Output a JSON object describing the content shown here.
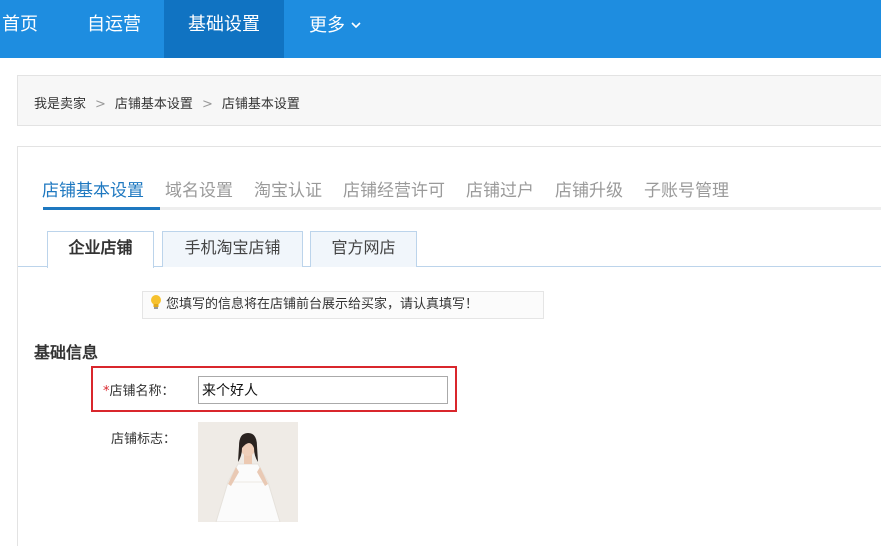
{
  "topnav": {
    "items": [
      {
        "label": "首页"
      },
      {
        "label": "自运营"
      },
      {
        "label": "基础设置"
      },
      {
        "label": "更多"
      }
    ],
    "more_chevron": "chevron-down-icon"
  },
  "breadcrumb": {
    "items": [
      "我是卖家",
      "店铺基本设置",
      "店铺基本设置"
    ],
    "separator": ">"
  },
  "primary_tabs": [
    "店铺基本设置",
    "域名设置",
    "淘宝认证",
    "店铺经营许可",
    "店铺过户",
    "店铺升级",
    "子账号管理"
  ],
  "secondary_tabs": [
    "企业店铺",
    "手机淘宝店铺",
    "官方网店"
  ],
  "notice": {
    "icon": "lightbulb-icon",
    "text": "您填写的信息将在店铺前台展示给买家，请认真填写！"
  },
  "form": {
    "section_title": "基础信息",
    "shop_name": {
      "required_mark": "*",
      "label": "店铺名称：",
      "value": "来个好人"
    },
    "shop_logo": {
      "label": "店铺标志："
    }
  },
  "colors": {
    "nav_bg": "#1e8de0",
    "nav_active": "#1073c2",
    "accent": "#1e78c0",
    "highlight_border": "#d9262c"
  }
}
